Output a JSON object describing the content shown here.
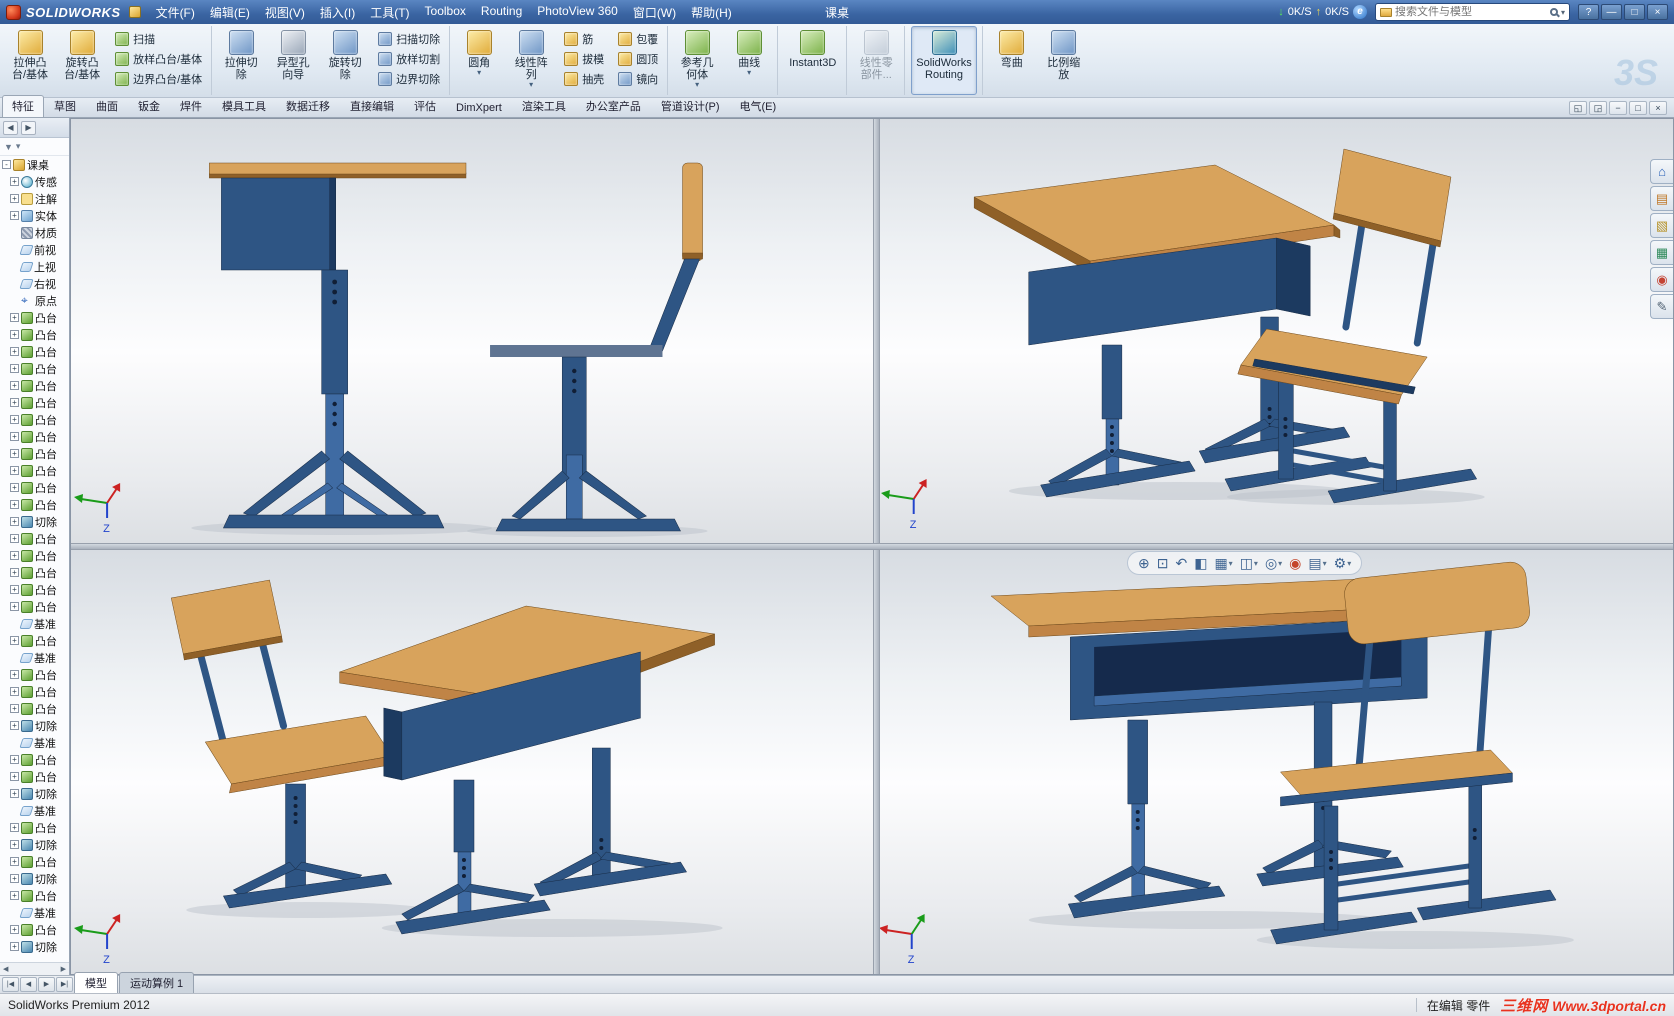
{
  "colors": {
    "wood": "#c08446",
    "wood_light": "#d8a35c",
    "wood_dark": "#8f6028",
    "steel": "#2e5584",
    "steel_light": "#3f6ba3",
    "steel_dark": "#1c3a60",
    "recess": "#152a4c",
    "seat_edge": "#5f7492",
    "watermark_red": "#e8321e"
  },
  "titlebar": {
    "app_name": "SOLIDWORKS",
    "menus": [
      {
        "label": "文件(F)"
      },
      {
        "label": "编辑(E)"
      },
      {
        "label": "视图(V)"
      },
      {
        "label": "插入(I)"
      },
      {
        "label": "工具(T)"
      },
      {
        "label": "Toolbox"
      },
      {
        "label": "Routing"
      },
      {
        "label": "PhotoView 360"
      },
      {
        "label": "窗口(W)"
      },
      {
        "label": "帮助(H)"
      }
    ],
    "doc_title": "课桌",
    "net": {
      "down_icon": "↓",
      "down": "0K/S",
      "up_icon": "↑",
      "up": "0K/S",
      "e": "e"
    },
    "search_placeholder": "搜索文件与模型",
    "window_buttons": [
      {
        "g": "?",
        "name": "help-button"
      },
      {
        "g": "—",
        "name": "minimize-button"
      },
      {
        "g": "□",
        "name": "restore-button"
      },
      {
        "g": "×",
        "name": "close-button"
      }
    ]
  },
  "ribbon": {
    "logo": "3S",
    "cells": [
      {
        "name": "extrude-boss-button",
        "label": "拉伸凸\n台/基体",
        "icon": "extrude-boss"
      },
      {
        "name": "revolve-boss-button",
        "label": "旋转凸\n台/基体",
        "icon": "revolve-boss"
      },
      {
        "items": [
          {
            "name": "sweep-button",
            "label": "扫描",
            "icon": "sweep"
          },
          {
            "name": "loft-button",
            "label": "放样凸台/基体",
            "icon": "loft"
          },
          {
            "name": "boundary-boss-button",
            "label": "边界凸台/基体",
            "icon": "boundary-boss"
          }
        ]
      },
      {
        "name": "extrude-cut-button",
        "label": "拉伸切\n除",
        "icon": "extrude-cut",
        "cls": "sep"
      },
      {
        "name": "hole-wizard-button",
        "label": "异型孔\n向导",
        "icon": "hole-wizard"
      },
      {
        "name": "revolve-cut-button",
        "label": "旋转切\n除",
        "icon": "revolve-cut"
      },
      {
        "items": [
          {
            "name": "swept-cut-button",
            "label": "扫描切除",
            "icon": "swept-cut"
          },
          {
            "name": "lofted-cut-button",
            "label": "放样切割",
            "icon": "lofted-cut"
          },
          {
            "name": "boundary-cut-button",
            "label": "边界切除",
            "icon": "boundary-cut"
          }
        ]
      },
      {
        "name": "fillet-button",
        "label": "圆角",
        "icon": "fillet",
        "arrow": true,
        "cls": "sep"
      },
      {
        "name": "linear-pattern-button",
        "label": "线性阵\n列",
        "icon": "linear-pattern",
        "arrow": true
      },
      {
        "items": [
          {
            "name": "rib-button",
            "label": "筋",
            "icon": "rib"
          },
          {
            "name": "draft-button",
            "label": "拔模",
            "icon": "draft"
          },
          {
            "name": "shell-button",
            "label": "抽壳",
            "icon": "shell"
          }
        ]
      },
      {
        "items": [
          {
            "name": "wrap-button",
            "label": "包覆",
            "icon": "wrap"
          },
          {
            "name": "dome-button",
            "label": "圆顶",
            "icon": "dome"
          },
          {
            "name": "mirror-button",
            "label": "镜向",
            "icon": "mirror"
          }
        ]
      },
      {
        "name": "reference-geometry-button",
        "label": "参考几\n何体",
        "icon": "reference-geometry",
        "arrow": true,
        "cls": "sep"
      },
      {
        "name": "curves-button",
        "label": "曲线",
        "icon": "curves",
        "arrow": true
      },
      {
        "name": "instant3d-button",
        "label": "Instant3D",
        "icon": "instant3d",
        "cls": "sep"
      },
      {
        "name": "linear-component-pattern-button",
        "label": "线性零\n部件...",
        "icon": "linear-component",
        "cls": "sep dis"
      },
      {
        "name": "solidworks-routing-button",
        "label": "SolidWorks\nRouting",
        "icon": "routing",
        "cls": "sep on"
      },
      {
        "name": "flex-button",
        "label": "弯曲",
        "icon": "flex",
        "cls": "sep"
      },
      {
        "name": "scale-button",
        "label": "比例缩\n放",
        "icon": "scale"
      }
    ]
  },
  "command_tabs": {
    "items": [
      {
        "label": "特征",
        "name": "tab-features",
        "cls": "active"
      },
      {
        "label": "草图",
        "name": "tab-sketch"
      },
      {
        "label": "曲面",
        "name": "tab-surfaces"
      },
      {
        "label": "钣金",
        "name": "tab-sheet-metal"
      },
      {
        "label": "焊件",
        "name": "tab-weldments"
      },
      {
        "label": "模具工具",
        "name": "tab-mold-tools"
      },
      {
        "label": "数据迁移",
        "name": "tab-data-migration"
      },
      {
        "label": "直接编辑",
        "name": "tab-direct-editing"
      },
      {
        "label": "评估",
        "name": "tab-evaluate"
      },
      {
        "label": "DimXpert",
        "name": "tab-dimxpert"
      },
      {
        "label": "渲染工具",
        "name": "tab-render-tools"
      },
      {
        "label": "办公室产品",
        "name": "tab-office-products"
      },
      {
        "label": "管道设计(P)",
        "name": "tab-piping"
      },
      {
        "label": "电气(E)",
        "name": "tab-electrical"
      }
    ],
    "window_controls": [
      {
        "g": "◱",
        "name": "viewport-layout-button"
      },
      {
        "g": "◲",
        "name": "viewport-split-button"
      },
      {
        "g": "−",
        "name": "doc-minimize-button"
      },
      {
        "g": "□",
        "name": "doc-restore-button"
      },
      {
        "g": "×",
        "name": "doc-close-button"
      }
    ]
  },
  "fmpanel": {
    "nav": [
      "◀",
      "▶"
    ],
    "filter_icon": "▼",
    "filter_arrow": "▾",
    "hscroll": [
      "◀",
      "▶"
    ]
  },
  "feature_tree": {
    "items": [
      {
        "label": "课桌",
        "icon": "part",
        "exp": "-"
      },
      {
        "label": "传感",
        "icon": "sensors",
        "exp": "+",
        "cls": "lv1"
      },
      {
        "label": "注解",
        "icon": "annotations",
        "exp": "+",
        "cls": "lv1"
      },
      {
        "label": "实体",
        "icon": "bodies",
        "exp": "+",
        "cls": "lv1"
      },
      {
        "label": "材质",
        "icon": "material",
        "exp": "",
        "cls": "lv1"
      },
      {
        "label": "前视",
        "icon": "plane",
        "exp": "",
        "cls": "lv1"
      },
      {
        "label": "上视",
        "icon": "plane",
        "exp": "",
        "cls": "lv1"
      },
      {
        "label": "右视",
        "icon": "plane",
        "exp": "",
        "cls": "lv1"
      },
      {
        "label": "原点",
        "icon": "origin",
        "exp": "",
        "cls": "lv1"
      },
      {
        "label": "凸台",
        "icon": "boss",
        "exp": "+",
        "cls": "lv1"
      },
      {
        "label": "凸台",
        "icon": "boss",
        "exp": "+",
        "cls": "lv1"
      },
      {
        "label": "凸台",
        "icon": "boss",
        "exp": "+",
        "cls": "lv1"
      },
      {
        "label": "凸台",
        "icon": "boss",
        "exp": "+",
        "cls": "lv1"
      },
      {
        "label": "凸台",
        "icon": "boss",
        "exp": "+",
        "cls": "lv1"
      },
      {
        "label": "凸台",
        "icon": "boss",
        "exp": "+",
        "cls": "lv1"
      },
      {
        "label": "凸台",
        "icon": "boss",
        "exp": "+",
        "cls": "lv1"
      },
      {
        "label": "凸台",
        "icon": "boss",
        "exp": "+",
        "cls": "lv1"
      },
      {
        "label": "凸台",
        "icon": "boss",
        "exp": "+",
        "cls": "lv1"
      },
      {
        "label": "凸台",
        "icon": "boss",
        "exp": "+",
        "cls": "lv1"
      },
      {
        "label": "凸台",
        "icon": "boss",
        "exp": "+",
        "cls": "lv1"
      },
      {
        "label": "凸台",
        "icon": "boss",
        "exp": "+",
        "cls": "lv1"
      },
      {
        "label": "切除",
        "icon": "cut",
        "exp": "+",
        "cls": "lv1"
      },
      {
        "label": "凸台",
        "icon": "boss",
        "exp": "+",
        "cls": "lv1"
      },
      {
        "label": "凸台",
        "icon": "boss",
        "exp": "+",
        "cls": "lv1"
      },
      {
        "label": "凸台",
        "icon": "boss",
        "exp": "+",
        "cls": "lv1"
      },
      {
        "label": "凸台",
        "icon": "boss",
        "exp": "+",
        "cls": "lv1"
      },
      {
        "label": "凸台",
        "icon": "boss",
        "exp": "+",
        "cls": "lv1"
      },
      {
        "label": "基准",
        "icon": "plane",
        "exp": "",
        "cls": "lv1"
      },
      {
        "label": "凸台",
        "icon": "boss",
        "exp": "+",
        "cls": "lv1"
      },
      {
        "label": "基准",
        "icon": "plane",
        "exp": "",
        "cls": "lv1"
      },
      {
        "label": "凸台",
        "icon": "boss",
        "exp": "+",
        "cls": "lv1"
      },
      {
        "label": "凸台",
        "icon": "boss",
        "exp": "+",
        "cls": "lv1"
      },
      {
        "label": "凸台",
        "icon": "boss",
        "exp": "+",
        "cls": "lv1"
      },
      {
        "label": "切除",
        "icon": "cut",
        "exp": "+",
        "cls": "lv1"
      },
      {
        "label": "基准",
        "icon": "plane",
        "exp": "",
        "cls": "lv1"
      },
      {
        "label": "凸台",
        "icon": "boss",
        "exp": "+",
        "cls": "lv1"
      },
      {
        "label": "凸台",
        "icon": "boss",
        "exp": "+",
        "cls": "lv1"
      },
      {
        "label": "切除",
        "icon": "cut",
        "exp": "+",
        "cls": "lv1"
      },
      {
        "label": "基准",
        "icon": "plane",
        "exp": "",
        "cls": "lv1"
      },
      {
        "label": "凸台",
        "icon": "boss",
        "exp": "+",
        "cls": "lv1"
      },
      {
        "label": "切除",
        "icon": "cut",
        "exp": "+",
        "cls": "lv1"
      },
      {
        "label": "凸台",
        "icon": "boss",
        "exp": "+",
        "cls": "lv1"
      },
      {
        "label": "切除",
        "icon": "cut",
        "exp": "+",
        "cls": "lv1"
      },
      {
        "label": "凸台",
        "icon": "boss",
        "exp": "+",
        "cls": "lv1"
      },
      {
        "label": "基准",
        "icon": "plane",
        "exp": "",
        "cls": "lv1"
      },
      {
        "label": "凸台",
        "icon": "boss",
        "exp": "+",
        "cls": "lv1"
      },
      {
        "label": "切除",
        "icon": "cut",
        "exp": "+",
        "cls": "lv1"
      }
    ]
  },
  "viewports": {
    "triad_axis_label": "Z"
  },
  "hud": {
    "items": [
      {
        "name": "zoom-to-fit-button",
        "g": "⊕"
      },
      {
        "name": "zoom-to-area-button",
        "g": "⊡"
      },
      {
        "name": "previous-view-button",
        "g": "↶"
      },
      {
        "name": "section-view-button",
        "g": "◧"
      },
      {
        "name": "view-orientation-button",
        "g": "▦",
        "arrow": true
      },
      {
        "name": "display-style-button",
        "g": "◫",
        "arrow": true
      },
      {
        "name": "hide-show-items-button",
        "g": "◎",
        "arrow": true
      },
      {
        "name": "edit-appearance-button",
        "g": "◉",
        "cls": "red"
      },
      {
        "name": "apply-scene-button",
        "g": "▤",
        "arrow": true
      },
      {
        "name": "view-settings-button",
        "g": "⚙",
        "arrow": true
      }
    ]
  },
  "taskpane": {
    "items": [
      {
        "name": "solidworks-resources-tab",
        "g": "⌂",
        "cls": "c1"
      },
      {
        "name": "design-library-tab",
        "g": "▤",
        "cls": "c2"
      },
      {
        "name": "file-explorer-tab",
        "g": "▧",
        "cls": "c3"
      },
      {
        "name": "view-palette-tab",
        "g": "▦",
        "cls": "c4"
      },
      {
        "name": "appearances-scenes-tab",
        "g": "◉",
        "cls": "c5"
      },
      {
        "name": "custom-properties-tab",
        "g": "✎",
        "cls": "c6"
      }
    ]
  },
  "docbar": {
    "scroll_buttons": [
      {
        "g": "|◀",
        "name": "doc-scroll-first"
      },
      {
        "g": "◀",
        "name": "doc-scroll-prev"
      },
      {
        "g": "▶",
        "name": "doc-scroll-next"
      },
      {
        "g": "▶|",
        "name": "doc-scroll-last"
      }
    ],
    "tabs": [
      {
        "label": "模型",
        "name": "tab-model",
        "cls": "active"
      },
      {
        "label": "运动算例 1",
        "name": "tab-motion-study-1"
      }
    ]
  },
  "statusbar": {
    "left": "SolidWorks Premium 2012",
    "editing": "在编辑 零件",
    "wm_cn": "三维网",
    "wm_url": "Www.3dportal.cn"
  }
}
